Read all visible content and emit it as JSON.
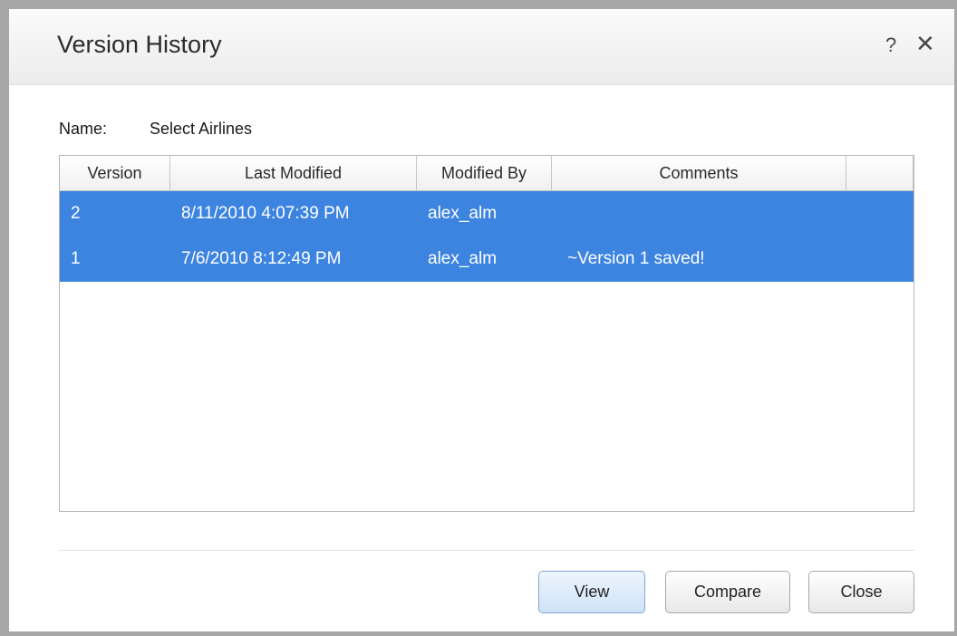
{
  "dialog": {
    "title": "Version History",
    "help_icon": "?",
    "close_icon": "✕"
  },
  "name": {
    "label": "Name:",
    "value": "Select Airlines"
  },
  "grid": {
    "columns": [
      "Version",
      "Last Modified",
      "Modified By",
      "Comments",
      ""
    ],
    "rows": [
      {
        "version": "2",
        "last_modified": "8/11/2010 4:07:39 PM",
        "modified_by": "alex_alm",
        "comments": ""
      },
      {
        "version": "1",
        "last_modified": "7/6/2010 8:12:49 PM",
        "modified_by": "alex_alm",
        "comments": "~Version 1 saved!"
      }
    ],
    "selection_color": "#3c84e0"
  },
  "buttons": {
    "view": "View",
    "compare": "Compare",
    "close": "Close"
  }
}
